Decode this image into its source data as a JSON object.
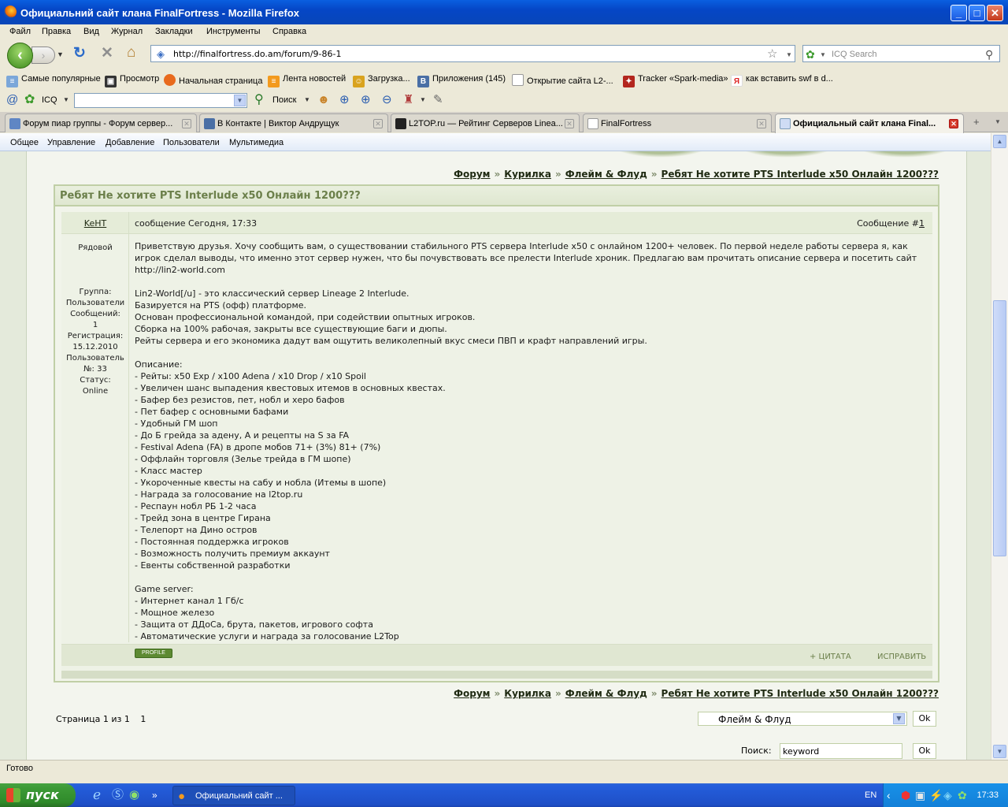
{
  "window": {
    "title": "Официальний сайт клана FinalFortress - Mozilla Firefox"
  },
  "menu": [
    "Файл",
    "Правка",
    "Вид",
    "Журнал",
    "Закладки",
    "Инструменты",
    "Справка"
  ],
  "nav": {
    "url": "http://finalfortress.do.am/forum/9-86-1",
    "search_placeholder": "ICQ Search"
  },
  "bookmarks": [
    {
      "label": "Самые популярные",
      "icon": "rss-icon"
    },
    {
      "label": "Просмотр",
      "icon": "app-icon"
    },
    {
      "label": "Начальная страница",
      "icon": "firefox-icon"
    },
    {
      "label": "Лента новостей",
      "icon": "rss-icon"
    },
    {
      "label": "Загрузка...",
      "icon": "anime-icon"
    },
    {
      "label": "Приложения (145)",
      "icon": "vk-icon"
    },
    {
      "label": "Открытие сайта L2-...",
      "icon": "page-icon"
    },
    {
      "label": "Tracker «Spark-media»",
      "icon": "tracker-icon"
    },
    {
      "label": "как вставить swf в d...",
      "icon": "yandex-icon"
    }
  ],
  "icq": {
    "label": "ICQ",
    "search_label": "Поиск"
  },
  "tabs": [
    {
      "label": "Форум пиар группы - Форум сервер..."
    },
    {
      "label": "В Контакте | Виктор Андрущук"
    },
    {
      "label": "L2TOP.ru — Рейтинг Серверов Linea..."
    },
    {
      "label": "FinalFortress"
    },
    {
      "label": "Официальный сайт клана Final..."
    }
  ],
  "adminbar": [
    "Общее",
    "Управление",
    "Добавление",
    "Пользователи",
    "Мультимедиа"
  ],
  "breadcrumb": [
    "Форум",
    "Курилка",
    "Флейм & Флуд",
    "Ребят Не хотите PTS Interlude x50 Онлайн 1200???"
  ],
  "breadcrumb_sep": "»",
  "thread": {
    "title": "Ребят Не хотите PTS Interlude x50 Онлайн 1200???"
  },
  "post": {
    "author": "KeHT",
    "meta": "сообщение Сегодня, 17:33",
    "number_label": "Сообщение #",
    "number": "1",
    "rank": "Рядовой",
    "user_info": [
      "Группа:",
      "Пользователи",
      "Сообщений:",
      "1",
      "Регистрация:",
      "15.12.2010",
      "Пользователь",
      "№: 33",
      "Статус:",
      "Online"
    ],
    "body": "Приветствую друзья. Хочу сообщить вам, о существовании стабильного PTS сервера Interlude x50 с онлайном 1200+ человек. По первой неделе работы сервера я, как игрок сделал выводы, что именно этот сервер нужен, что бы почувствовать все прелести Interlude хроник. Предлагаю вам прочитать описание сервера и посетить сайт http://lin2-world.com\n\nLin2-World[/u] - это классический сервер Lineage 2 Interlude.\nБазируется на PTS (офф) платформе.\nОснован профессиональной командой, при содействии опытных игроков.\nСборка на 100% рабочая, закрыты все существующие баги и дюпы.\nРейты сервера и его экономика дадут вам ощутить великолепный вкус смеси ПВП и крафт направлений игры.\n\nОписание:\n- Рейты: x50 Exp / x100 Adena / x10 Drop / x10 Spoil\n- Увеличен шанс выпадения квестовых итемов в основных квестах.\n- Бафер без резистов, пет, нобл и херо бафов\n- Пет бафер с основными бафами\n- Удобный ГМ шоп\n- До Б грейда за адену, А и рецепты на S за FA\n- Festival Adena (FA) в дропе мобов 71+ (3%) 81+ (7%)\n- Оффлайн торговля (Зелье трейда в ГМ шопе)\n- Класс мастер\n- Укороченные квесты на сабу и нобла (Итемы в шопе)\n- Награда за голосование на l2top.ru\n- Респаун нобл РБ 1-2 часа\n- Трейд зона в центре Гирана\n- Телепорт на Дино остров\n- Постоянная поддержка игроков\n- Возможность получить премиум аккаунт\n- Евенты собственной разработки\n\nGame server:\n- Интернет канал 1 Гб/с\n- Мощное железо\n- Защита от ДДоСа, брута, пакетов, игрового софта\n- Автоматические услуги и награда за голосование L2Top",
    "profile_label": "PROFILE",
    "quote_label": "+ ЦИТАТА",
    "edit_label": "ИСПРАВИТЬ"
  },
  "pagination": {
    "text": "Страница 1 из 1",
    "current": "1"
  },
  "jump": {
    "selected": "Флейм & Флуд",
    "ok": "Ok"
  },
  "search": {
    "label": "Поиск:",
    "value": "keyword",
    "ok": "Ok"
  },
  "status": "Готово",
  "taskbar": {
    "start": "пуск",
    "item": "Официальний сайт ...",
    "lang": "EN",
    "clock": "17:33"
  }
}
